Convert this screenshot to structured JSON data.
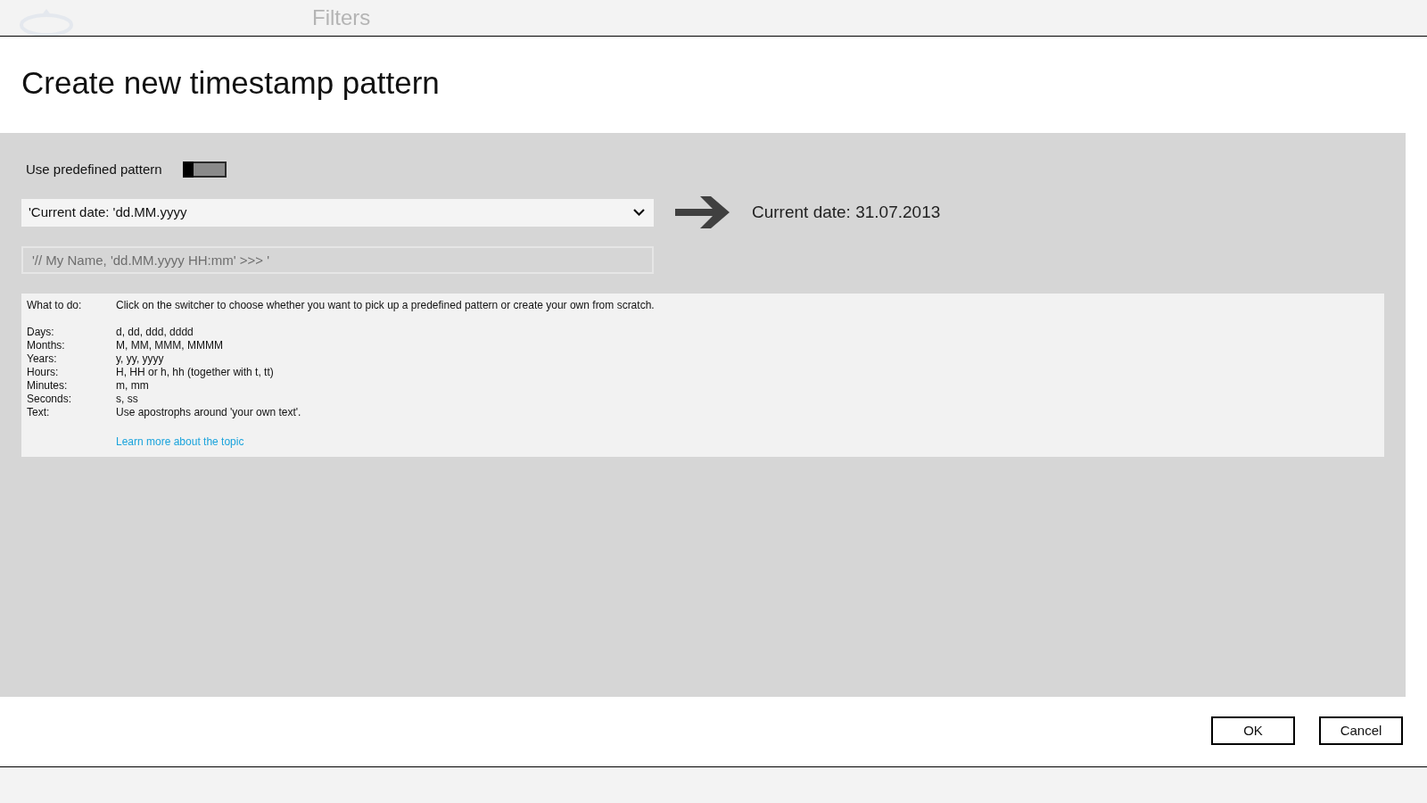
{
  "background_app": {
    "title": "Filters"
  },
  "dialog": {
    "title": "Create new timestamp pattern",
    "predefined_toggle": {
      "label": "Use predefined pattern",
      "on": false
    },
    "pattern_dropdown": {
      "value": "'Current date: 'dd.MM.yyyy"
    },
    "preview": "Current date: 31.07.2013",
    "custom_pattern": {
      "placeholder": "'// My Name, 'dd.MM.yyyy HH:mm' >>> '"
    },
    "help": {
      "intro": {
        "label": "What to do:",
        "text": "Click on the switcher to choose whether you want to pick up a predefined pattern or create your own from scratch."
      },
      "rows": [
        {
          "label": "Days:",
          "text": "d, dd, ddd, dddd"
        },
        {
          "label": "Months:",
          "text": "M, MM, MMM, MMMM"
        },
        {
          "label": "Years:",
          "text": "y, yy, yyyy"
        },
        {
          "label": "Hours:",
          "text": "H, HH or h, hh (together with t, tt)"
        },
        {
          "label": "Minutes:",
          "text": "m, mm"
        },
        {
          "label": "Seconds:",
          "text": "s, ss"
        },
        {
          "label": "Text:",
          "text": "Use apostrophs around 'your own text'."
        }
      ],
      "link": "Learn more about the topic"
    },
    "buttons": [
      {
        "label": "OK"
      },
      {
        "label": "Cancel"
      }
    ]
  }
}
